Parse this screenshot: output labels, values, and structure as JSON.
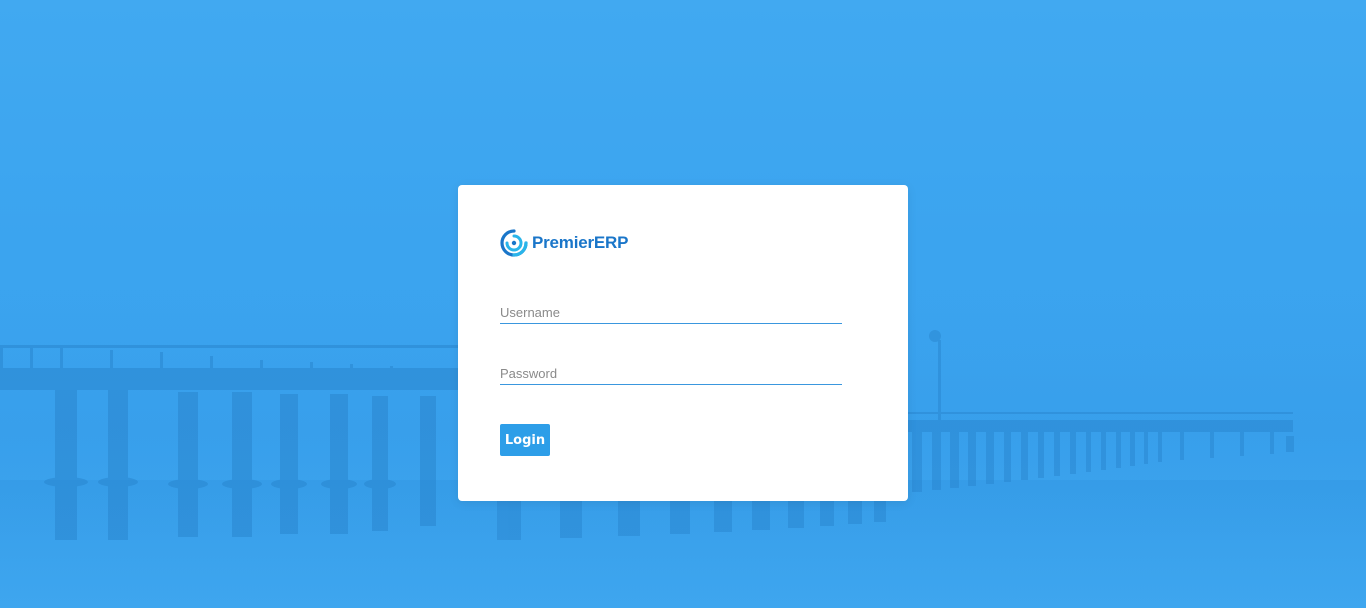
{
  "brand": {
    "name": "PremierERP",
    "logo_icon": "swirl-logo-icon",
    "color": "#1a76c9"
  },
  "form": {
    "username_placeholder": "Username",
    "username_value": "",
    "password_placeholder": "Password",
    "password_value": "",
    "login_label": "Login"
  },
  "theme": {
    "background": "#3ba4ef",
    "accent": "#2d9ee8",
    "card": "#ffffff"
  }
}
